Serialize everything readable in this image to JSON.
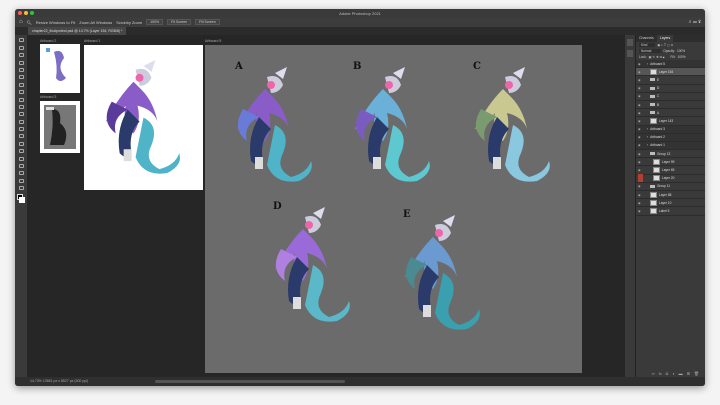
{
  "window": {
    "title": "Adobe Photoshop 2021"
  },
  "options": {
    "resize": "Resize Windows to Fit",
    "zoom_all": "Zoom All Windows",
    "scrubby": "Scrubby Zoom",
    "zoom_pct": "100%",
    "fit": "Fit Screen",
    "fill": "Fill Screen"
  },
  "document_tab": "chapter22_finalprotect.psd @ 14.7% (Layer 154, RGB/8) *",
  "artboards": [
    {
      "label": "Artboard 2"
    },
    {
      "label": "Artboard 3"
    },
    {
      "label": "Artboard 1"
    },
    {
      "label": "Artboard 5"
    }
  ],
  "variants": [
    "A",
    "B",
    "C",
    "D",
    "E"
  ],
  "colors": {
    "accent": "#4fb4c8",
    "purple": "#8a5cc8",
    "canvas_gray": "#6b6b6b"
  },
  "layers_panel": {
    "tabs": [
      "Channels",
      "Layers"
    ],
    "kind": "Kind",
    "blend": "Normal",
    "opacity_label": "Opacity:",
    "opacity": "100%",
    "lock_label": "Lock:",
    "fill_label": "Fill:",
    "fill": "100%",
    "layers": [
      {
        "name": "Artboard 5",
        "type": "artboard",
        "indent": 0
      },
      {
        "name": "Layer 154",
        "type": "pixel",
        "indent": 1,
        "selected": true
      },
      {
        "name": "E",
        "type": "folder",
        "indent": 1
      },
      {
        "name": "D",
        "type": "folder",
        "indent": 1
      },
      {
        "name": "C",
        "type": "folder",
        "indent": 1
      },
      {
        "name": "B",
        "type": "folder",
        "indent": 1
      },
      {
        "name": "A",
        "type": "folder",
        "indent": 1
      },
      {
        "name": "Layer 143",
        "type": "pixel",
        "indent": 1
      },
      {
        "name": "Artboard 3",
        "type": "artboard",
        "indent": 0
      },
      {
        "name": "Artboard 2",
        "type": "artboard",
        "indent": 0
      },
      {
        "name": "Artboard 1",
        "type": "artboard",
        "indent": 0
      },
      {
        "name": "Group 13",
        "type": "folder",
        "indent": 1
      },
      {
        "name": "Layer 99",
        "type": "pixel",
        "indent": 2
      },
      {
        "name": "Layer 65",
        "type": "pixel",
        "indent": 2
      },
      {
        "name": "Layer 20",
        "type": "pixel",
        "indent": 2
      },
      {
        "name": "Group 11",
        "type": "folder",
        "indent": 1
      },
      {
        "name": "Layer 88",
        "type": "pixel",
        "indent": 1
      },
      {
        "name": "Layer 10",
        "type": "pixel",
        "indent": 1
      },
      {
        "name": "Label 5",
        "type": "pixel",
        "indent": 1
      }
    ]
  },
  "status": "14.73%   13661 px x 8527 px (300 ppi)"
}
